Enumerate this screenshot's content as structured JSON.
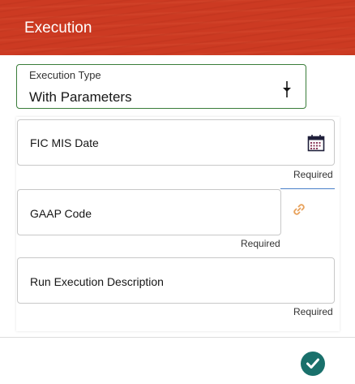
{
  "dialog": {
    "title": "Execution"
  },
  "execution_type": {
    "label": "Execution Type",
    "value": "With Parameters"
  },
  "parameters": {
    "fic_mis_date": {
      "label": "FIC MIS Date",
      "hint": "Required"
    },
    "gaap_code": {
      "label": "GAAP Code",
      "hint": "Required"
    },
    "run_execution_description": {
      "label": "Run Execution Description",
      "hint": "Required"
    }
  },
  "icons": {
    "dropdown": "dropdown-arrow-icon",
    "calendar": "calendar-icon",
    "link": "link-icon",
    "ok": "checkmark-icon"
  },
  "colors": {
    "header_bg": "#cc3a22",
    "select_border": "#3a7d3a",
    "link_icon": "#e8a15a",
    "focus_line": "#4a7fc8",
    "ok_button": "#19706b"
  }
}
